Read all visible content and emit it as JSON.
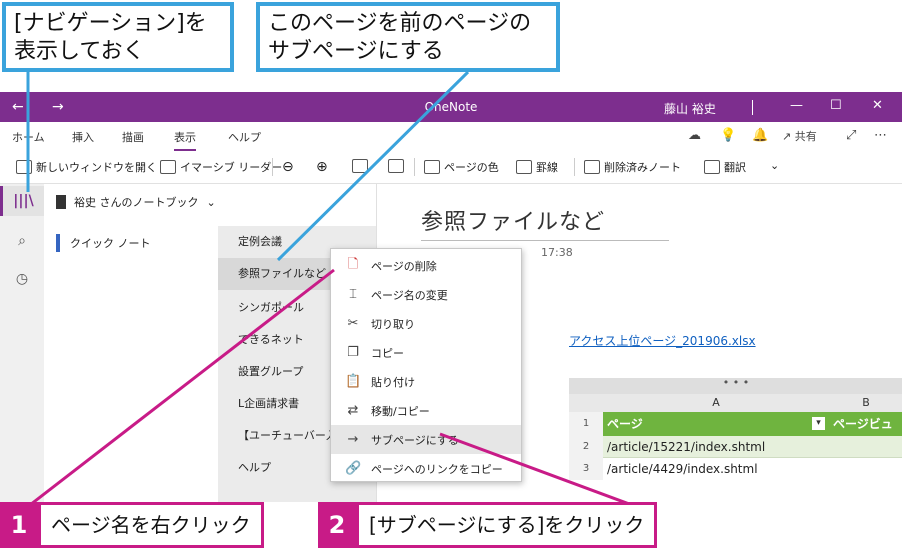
{
  "callouts": {
    "left": "[ナビゲーション]を表示しておく",
    "right": "このページを前のページのサブページにする"
  },
  "titlebar": {
    "back_icon": "←",
    "forward_icon": "→",
    "title": "OneNote",
    "user": "藤山 裕史",
    "minimize": "—",
    "maximize": "☐",
    "close": "✕"
  },
  "tabs": {
    "home": "ホーム",
    "insert": "挿入",
    "draw": "描画",
    "view": "表示",
    "help": "ヘルプ",
    "share": "共有"
  },
  "toolbar": {
    "new_window": "新しいウィンドウを開く",
    "immersive_reader": "イマーシブ リーダー",
    "page_color": "ページの色",
    "rule_lines": "罫線",
    "deleted_notes": "削除済みノート",
    "translate": "翻訳"
  },
  "notebook": {
    "name": "裕史 さんのノートブック"
  },
  "sections": [
    {
      "label": "クイック ノート"
    }
  ],
  "pages": [
    {
      "label": "定例会議"
    },
    {
      "label": "参照ファイルなど"
    },
    {
      "label": "シンガポール"
    },
    {
      "label": "できるネット"
    },
    {
      "label": "設置グループ"
    },
    {
      "label": "L企画請求書"
    },
    {
      "label": "【ユーチューバー入門】"
    },
    {
      "label": "ヘルプ"
    }
  ],
  "content": {
    "title": "参照ファイルなど",
    "time": "17:38",
    "attachment": "アクセス上位ページ_201906.xlsx"
  },
  "sheet": {
    "dots": "• • •",
    "col_a": "A",
    "col_b": "B",
    "rows": [
      "1",
      "2",
      "3"
    ],
    "header_a": "ページ",
    "header_b": "ページビュ",
    "cells": [
      "/article/15221/index.shtml",
      "/article/4429/index.shtml"
    ]
  },
  "context_menu": [
    {
      "label": "ページの削除",
      "icon": "delete-page-icon"
    },
    {
      "label": "ページ名の変更",
      "icon": "rename-icon"
    },
    {
      "label": "切り取り",
      "icon": "scissors-icon"
    },
    {
      "label": "コピー",
      "icon": "copy-icon"
    },
    {
      "label": "貼り付け",
      "icon": "paste-icon"
    },
    {
      "label": "移動/コピー",
      "icon": "move-icon"
    },
    {
      "label": "サブページにする",
      "icon": "arrow-right-icon"
    },
    {
      "label": "ページへのリンクをコピー",
      "icon": "link-icon"
    }
  ],
  "steps": [
    {
      "number": "1",
      "text": "ページ名を右クリック"
    },
    {
      "number": "2",
      "text": "[サブページにする]をクリック"
    }
  ],
  "colors": {
    "accent": "#7d2e8e",
    "callout_border": "#3aa3dc",
    "step": "#c81b87",
    "sheet_header": "#6fb43f"
  }
}
